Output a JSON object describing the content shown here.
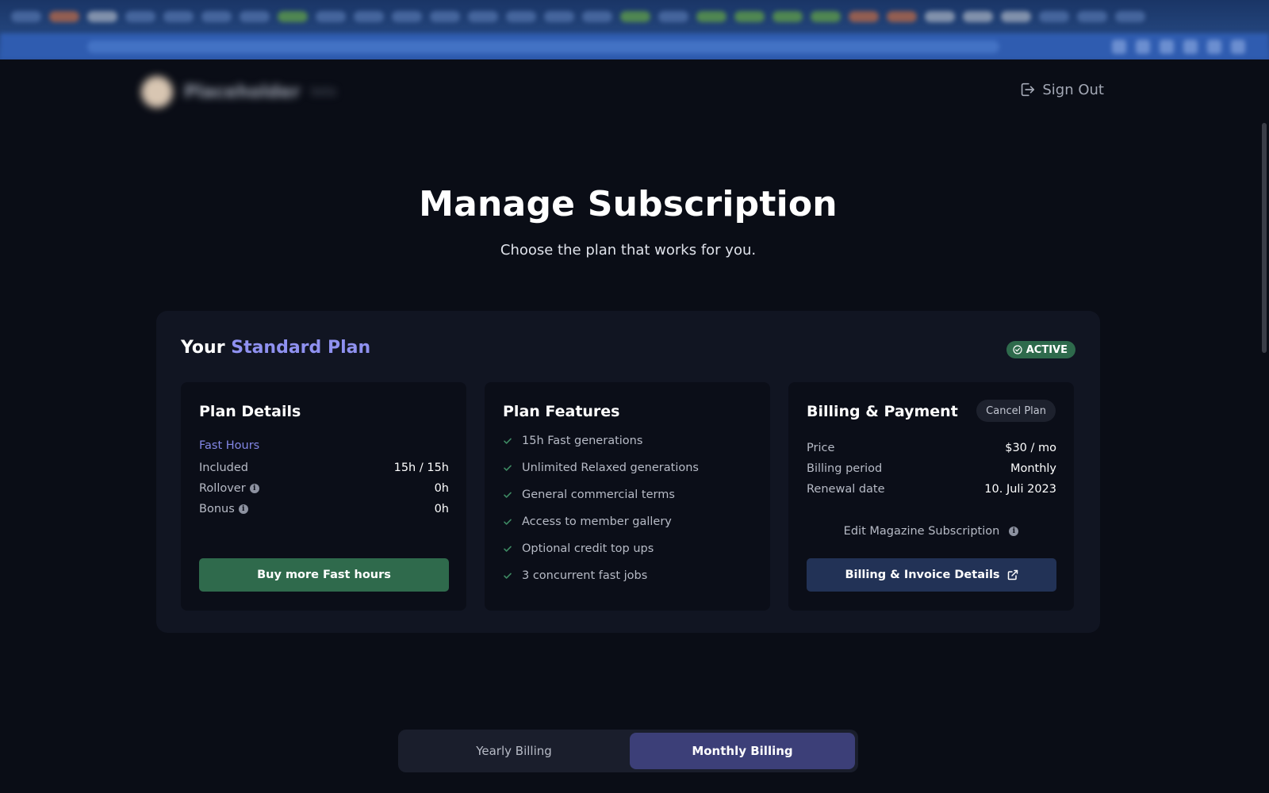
{
  "header": {
    "brand_name": "Placeholder",
    "brand_sub": "beta",
    "sign_out_label": "Sign Out"
  },
  "page": {
    "title": "Manage Subscription",
    "subtitle": "Choose the plan that works for you."
  },
  "plan": {
    "title_prefix": "Your",
    "plan_name": "Standard Plan",
    "status_badge": "ACTIVE",
    "colors": {
      "accent": "#8f91f0",
      "active": "#2e6a4c",
      "primary_button": "#2f6a4c",
      "secondary_button": "#223256"
    }
  },
  "plan_details": {
    "title": "Plan Details",
    "section_label": "Fast Hours",
    "rows": [
      {
        "label": "Included",
        "value": "15h / 15h"
      },
      {
        "label": "Rollover",
        "value": "0h"
      },
      {
        "label": "Bonus",
        "value": "0h"
      }
    ],
    "buy_button": "Buy more Fast hours"
  },
  "plan_features": {
    "title": "Plan Features",
    "items": [
      "15h Fast generations",
      "Unlimited Relaxed generations",
      "General commercial terms",
      "Access to member gallery",
      "Optional credit top ups",
      "3 concurrent fast jobs"
    ]
  },
  "billing": {
    "title": "Billing & Payment",
    "cancel_button": "Cancel Plan",
    "rows": [
      {
        "label": "Price",
        "value": "$30 / mo"
      },
      {
        "label": "Billing period",
        "value": "Monthly"
      },
      {
        "label": "Renewal date",
        "value": "10. Juli 2023"
      }
    ],
    "edit_magazine": "Edit Magazine Subscription",
    "invoice_button": "Billing & Invoice Details"
  },
  "billing_toggle": {
    "options": [
      "Yearly Billing",
      "Monthly Billing"
    ],
    "selected": "Monthly Billing"
  }
}
